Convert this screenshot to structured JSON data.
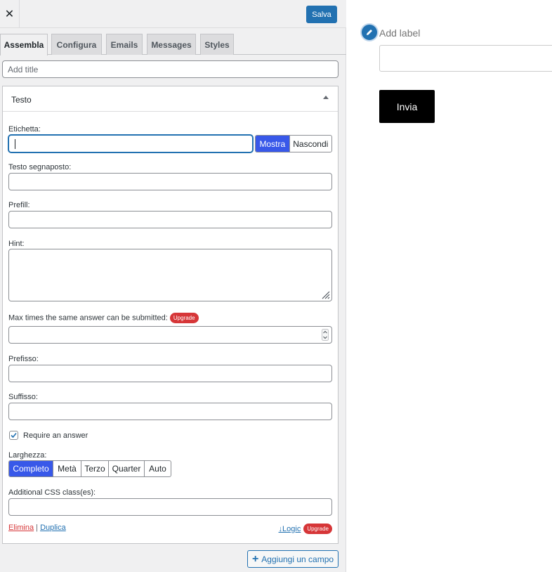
{
  "toolbar": {
    "close_glyph": "✕",
    "save_label": "Salva"
  },
  "tabs": [
    {
      "label": "Assembla",
      "active": true
    },
    {
      "label": "Configura",
      "active": false
    },
    {
      "label": "Emails",
      "active": false
    },
    {
      "label": "Messages",
      "active": false
    },
    {
      "label": "Styles",
      "active": false
    }
  ],
  "form": {
    "title_placeholder": "Add title"
  },
  "field": {
    "type_label": "Testo",
    "label_label": "Etichetta:",
    "label_value": "",
    "label_visibility": {
      "show": "Mostra",
      "hide": "Nascondi",
      "selected": "Mostra"
    },
    "placeholder_label": "Testo segnaposto:",
    "prefill_label": "Prefill:",
    "hint_label": "Hint:",
    "max_times_label": "Max times the same answer can be submitted:",
    "upgrade_badge": "Upgrade",
    "prefix_label": "Prefisso:",
    "suffix_label": "Suffisso:",
    "required_label": "Require an answer",
    "required_checked": true,
    "width_label": "Larghezza:",
    "width_options": [
      "Completo",
      "Metà",
      "Terzo",
      "Quarter",
      "Auto"
    ],
    "width_selected": "Completo",
    "css_label": "Additional CSS class(es):",
    "delete_link": "Elimina",
    "separator": "|",
    "duplicate_link": "Duplica",
    "logic_link": "↓Logic",
    "logic_badge": "Upgrade"
  },
  "add_field": {
    "plus": "+",
    "label": "Aggiungi un campo"
  },
  "preview": {
    "add_label": "Add label",
    "submit_label": "Invia"
  },
  "colors": {
    "primary": "#2271b1",
    "toggle_active": "#3858e9",
    "upgrade_badge": "#d63638",
    "submit_bg": "#000000"
  }
}
